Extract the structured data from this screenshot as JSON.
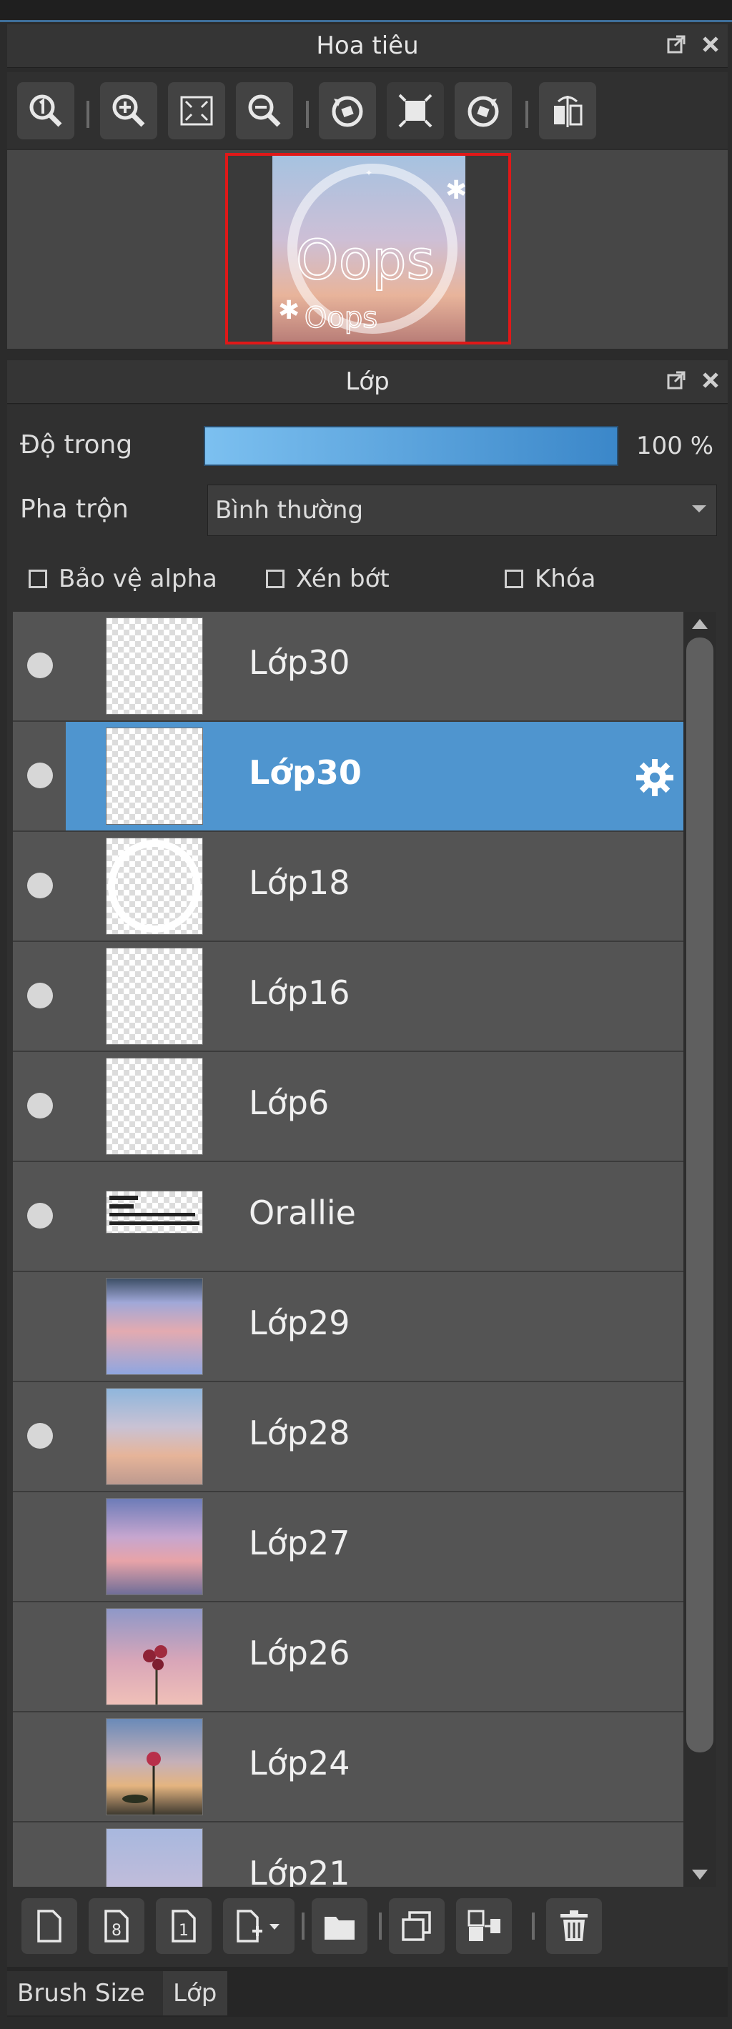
{
  "navigator": {
    "title": "Hoa tiêu"
  },
  "thumbnail_text": {
    "big": "Oops",
    "small": "Oops"
  },
  "layer_panel": {
    "title": "Lớp",
    "opacity_label": "Độ trong",
    "opacity_value": "100 %",
    "opacity_fraction": 1.0,
    "blend_label": "Pha trộn",
    "blend_value": "Bình thường",
    "checkboxes": [
      {
        "label": "Bảo vệ alpha",
        "checked": false
      },
      {
        "label": "Xén bớt",
        "checked": false
      },
      {
        "label": "Khóa",
        "checked": false
      }
    ],
    "layers": [
      {
        "name": "Lớp30",
        "visible": true,
        "selected": false
      },
      {
        "name": "Lớp30",
        "visible": true,
        "selected": true
      },
      {
        "name": "Lớp18",
        "visible": true,
        "selected": false
      },
      {
        "name": "Lớp16",
        "visible": true,
        "selected": false
      },
      {
        "name": "Lớp6",
        "visible": true,
        "selected": false
      },
      {
        "name": "Orallie",
        "visible": true,
        "selected": false
      },
      {
        "name": "Lớp29",
        "visible": false,
        "selected": false
      },
      {
        "name": "Lớp28",
        "visible": true,
        "selected": false
      },
      {
        "name": "Lớp27",
        "visible": false,
        "selected": false
      },
      {
        "name": "Lớp26",
        "visible": false,
        "selected": false
      },
      {
        "name": "Lớp24",
        "visible": false,
        "selected": false
      },
      {
        "name": "Lớp21",
        "visible": false,
        "selected": false
      }
    ]
  },
  "tabs": [
    {
      "label": "Brush Size",
      "active": false
    },
    {
      "label": "Lớp",
      "active": true
    }
  ],
  "icons": {
    "navigator_toolbar": [
      "zoom-actual-icon",
      "zoom-in-icon",
      "fit-screen-icon",
      "zoom-out-icon",
      "rotate-left-icon",
      "reset-view-icon",
      "rotate-right-icon",
      "flip-horizontal-icon"
    ],
    "bottom_toolbar": [
      "new-layer-icon",
      "new-8bit-layer-icon",
      "new-1bit-layer-icon",
      "add-special-layer-icon",
      "new-folder-icon",
      "duplicate-layer-icon",
      "merge-layer-icon",
      "delete-layer-icon"
    ]
  },
  "colors": {
    "accent": "#4f95cf",
    "thumbnail_border": "#e01818"
  }
}
